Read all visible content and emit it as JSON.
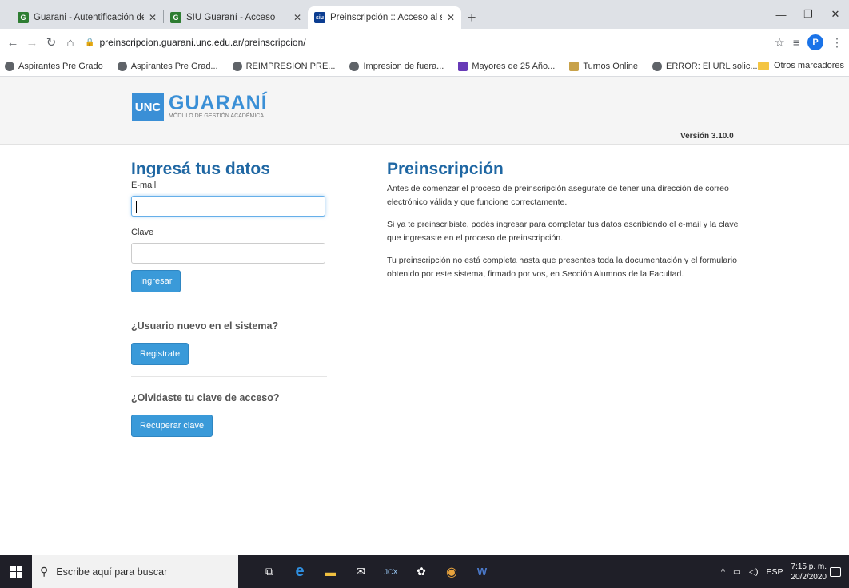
{
  "browser": {
    "tabs": [
      {
        "title": "Guarani - Autentificación de Usu",
        "fav": "G",
        "fav_color": "#2e7d32",
        "active": false
      },
      {
        "title": "SIU Guaraní - Acceso",
        "fav": "G",
        "fav_color": "#2e7d32",
        "active": false
      },
      {
        "title": "Preinscripción :: Acceso al sistem",
        "fav": "siu",
        "fav_color": "#0b3d91",
        "active": true
      }
    ],
    "url": "preinscripcion.guarani.unc.edu.ar/preinscripcion/",
    "profile_initial": "P",
    "bookmarks": [
      {
        "label": "Aspirantes Pre Grado",
        "icon": "globe-icon"
      },
      {
        "label": "Aspirantes Pre Grad...",
        "icon": "globe-icon"
      },
      {
        "label": "REIMPRESION PRE...",
        "icon": "globe-icon"
      },
      {
        "label": "Impresion de fuera...",
        "icon": "globe-icon"
      },
      {
        "label": "Mayores de 25 Año...",
        "icon": "calendar-icon"
      },
      {
        "label": "Turnos Online",
        "icon": "trophy-icon"
      },
      {
        "label": "ERROR: El URL solic...",
        "icon": "globe-icon"
      }
    ],
    "other_bookmarks": "Otros marcadores"
  },
  "header": {
    "logo_unc": "UNC",
    "logo_title": "GUARANÍ",
    "logo_subtitle": "MÓDULO DE GESTIÓN ACADÉMICA",
    "version": "Versión 3.10.0"
  },
  "login": {
    "title": "Ingresá tus datos",
    "email_label": "E-mail",
    "email_value": "",
    "password_label": "Clave",
    "password_value": "",
    "submit_label": "Ingresar",
    "new_user_text": "¿Usuario nuevo en el sistema?",
    "register_label": "Registrate",
    "forgot_text": "¿Olvidaste tu clave de acceso?",
    "recover_label": "Recuperar clave"
  },
  "info": {
    "title": "Preinscripción",
    "paragraphs": [
      "Antes de comenzar el proceso de preinscripción asegurate de tener una dirección de correo electrónico válida y que funcione correctamente.",
      "Si ya te preinscribiste, podés ingresar para completar tus datos escribiendo el e-mail y la clave que ingresaste en el proceso de preinscripción.",
      "Tu preinscripción no está completa hasta que presentes toda la documentación y el formulario obtenido por este sistema, firmado por vos, en Sección Alumnos de la Facultad."
    ]
  },
  "taskbar": {
    "search_placeholder": "Escribe aquí para buscar",
    "language": "ESP",
    "time": "7:15 p. m.",
    "date": "20/2/2020"
  }
}
